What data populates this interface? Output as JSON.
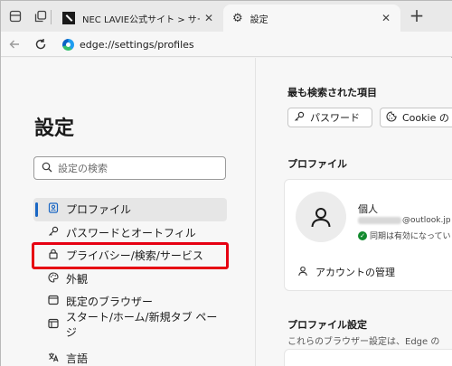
{
  "tabs": {
    "inactive_title": "NEC LAVIE公式サイト > サービス&サポ",
    "active_title": "設定",
    "close_glyph": "✕",
    "new_tab_glyph": "+"
  },
  "address": {
    "url": "edge://settings/profiles"
  },
  "sidebar": {
    "title": "設定",
    "search_placeholder": "設定の検索",
    "items": [
      {
        "label": "プロファイル",
        "icon": "person-card-icon",
        "selected": true
      },
      {
        "label": "パスワードとオートフィル",
        "icon": "key-icon"
      },
      {
        "label": "プライバシー/検索/サービス",
        "icon": "lock-icon",
        "highlighted": true
      },
      {
        "label": "外観",
        "icon": "palette-icon"
      },
      {
        "label": "既定のブラウザー",
        "icon": "browser-icon"
      },
      {
        "label": "スタート/ホーム/新規タブ ページ",
        "icon": "home-window-icon"
      },
      {
        "label": "言語",
        "icon": "language-icon"
      }
    ]
  },
  "main": {
    "top_searched_title": "最も検索された項目",
    "chips": [
      {
        "label": "パスワード",
        "icon": "key-icon"
      },
      {
        "label": "Cookie の",
        "icon": "cookie-icon"
      }
    ],
    "profile_section_title": "プロファイル",
    "profile": {
      "name": "個人",
      "email_suffix": "@outlook.jp",
      "sync_status": "同期は有効になってい",
      "manage_label": "アカウントの管理"
    },
    "profile_settings_title": "プロファイル設定",
    "profile_settings_desc": "これらのブラウザー設定は、Edge の"
  },
  "colors": {
    "accent": "#1a67c4",
    "highlight_border": "#e60012",
    "sync_green": "#128a2e"
  }
}
